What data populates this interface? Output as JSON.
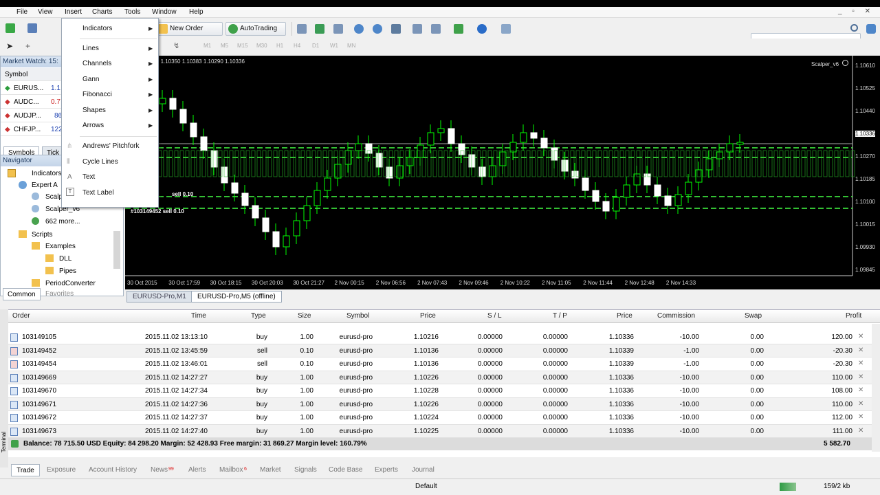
{
  "menubar": {
    "items": [
      "File",
      "View",
      "Insert",
      "Charts",
      "Tools",
      "Window",
      "Help"
    ]
  },
  "toolbar": {
    "new_order": "New Order",
    "autotrading": "AutoTrading",
    "timeframes": [
      "M1",
      "M5",
      "M15",
      "M30",
      "H1",
      "H4",
      "D1",
      "W1",
      "MN"
    ]
  },
  "market_watch": {
    "title": "Market Watch: 15:",
    "col_symbol": "Symbol",
    "rows": [
      {
        "symbol": "EURUS...",
        "val": "1.1"
      },
      {
        "symbol": "AUDC...",
        "val": "0.7"
      },
      {
        "symbol": "AUDJP...",
        "val": "86"
      },
      {
        "symbol": "CHFJP...",
        "val": "122"
      }
    ],
    "tabs": [
      "Symbols",
      "Tick"
    ]
  },
  "navigator": {
    "title": "Navigator",
    "items": [
      "Indicators",
      "Expert A",
      "Scalp",
      "Scalper_v6",
      "662 more...",
      "Scripts",
      "Examples",
      "DLL",
      "Pipes",
      "PeriodConverter"
    ],
    "tabs": [
      "Common",
      "Favorites"
    ]
  },
  "context_menu": {
    "items": [
      "Indicators",
      "Lines",
      "Channels",
      "Gann",
      "Fibonacci",
      "Shapes",
      "Arrows",
      "Andrews' Pitchfork",
      "Cycle Lines",
      "Text",
      "Text Label"
    ]
  },
  "chart": {
    "header": "USD-Pro,M5  1.10350 1.10383 1.10290 1.10336",
    "ea_name": "Scalper_v6",
    "prices": [
      "1.10610",
      "1.10525",
      "1.10440",
      "1.10336",
      "1.10270",
      "1.10185",
      "1.10100",
      "1.10015",
      "1.09930",
      "1.09845"
    ],
    "times": [
      "30 Oct 2015",
      "30 Oct 17:59",
      "30 Oct 18:15",
      "30 Oct 20:03",
      "30 Oct 21:27",
      "2 Nov 00:15",
      "2 Nov 06:56",
      "2 Nov 07:43",
      "2 Nov 09:46",
      "2 Nov 10:22",
      "2 Nov 11:05",
      "2 Nov 11:44",
      "2 Nov 12:48",
      "2 Nov 14:33"
    ],
    "labels": [
      "sell 0.10",
      "#103149452 sell 0.10"
    ],
    "tabs": [
      "EURUSD-Pro,M1",
      "EURUSD-Pro,M5 (offline)"
    ]
  },
  "terminal": {
    "side_label": "Terminal",
    "columns": [
      "Order",
      "Time",
      "Type",
      "Size",
      "Symbol",
      "Price",
      "S / L",
      "T / P",
      "Price",
      "Commission",
      "Swap",
      "Profit"
    ],
    "rows": [
      [
        "103149105",
        "2015.11.02 13:13:10",
        "buy",
        "1.00",
        "eurusd-pro",
        "1.10216",
        "0.00000",
        "0.00000",
        "1.10336",
        "-10.00",
        "0.00",
        "120.00"
      ],
      [
        "103149452",
        "2015.11.02 13:45:59",
        "sell",
        "0.10",
        "eurusd-pro",
        "1.10136",
        "0.00000",
        "0.00000",
        "1.10339",
        "-1.00",
        "0.00",
        "-20.30"
      ],
      [
        "103149454",
        "2015.11.02 13:46:01",
        "sell",
        "0.10",
        "eurusd-pro",
        "1.10136",
        "0.00000",
        "0.00000",
        "1.10339",
        "-1.00",
        "0.00",
        "-20.30"
      ],
      [
        "103149669",
        "2015.11.02 14:27:27",
        "buy",
        "1.00",
        "eurusd-pro",
        "1.10226",
        "0.00000",
        "0.00000",
        "1.10336",
        "-10.00",
        "0.00",
        "110.00"
      ],
      [
        "103149670",
        "2015.11.02 14:27:34",
        "buy",
        "1.00",
        "eurusd-pro",
        "1.10228",
        "0.00000",
        "0.00000",
        "1.10336",
        "-10.00",
        "0.00",
        "108.00"
      ],
      [
        "103149671",
        "2015.11.02 14:27:36",
        "buy",
        "1.00",
        "eurusd-pro",
        "1.10226",
        "0.00000",
        "0.00000",
        "1.10336",
        "-10.00",
        "0.00",
        "110.00"
      ],
      [
        "103149672",
        "2015.11.02 14:27:37",
        "buy",
        "1.00",
        "eurusd-pro",
        "1.10224",
        "0.00000",
        "0.00000",
        "1.10336",
        "-10.00",
        "0.00",
        "112.00"
      ],
      [
        "103149673",
        "2015.11.02 14:27:40",
        "buy",
        "1.00",
        "eurusd-pro",
        "1.10225",
        "0.00000",
        "0.00000",
        "1.10336",
        "-10.00",
        "0.00",
        "111.00"
      ]
    ],
    "balance": "Balance: 78 715.50 USD  Equity: 84 298.20  Margin: 52 428.93  Free margin: 31 869.27  Margin level: 160.79%",
    "total_profit": "5 582.70",
    "tabs": [
      "Trade",
      "Exposure",
      "Account History",
      "News",
      "Alerts",
      "Mailbox",
      "Market",
      "Signals",
      "Code Base",
      "Experts",
      "Journal"
    ],
    "news_badge": "99",
    "mailbox_badge": "6"
  },
  "status": {
    "profile": "Default",
    "traffic": "159/2 kb"
  },
  "colors": {
    "bull": "#00ff00",
    "bear": "#ffffff",
    "bg": "#000000",
    "accent": "#2a6cc8"
  }
}
